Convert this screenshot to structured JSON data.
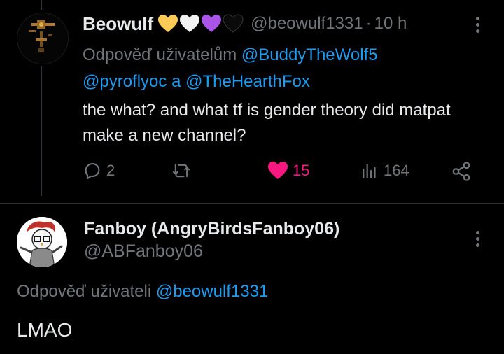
{
  "tweet1": {
    "display_name": "Beowulf",
    "badges": [
      "yellow-heart",
      "white-heart",
      "purple-heart",
      "black-heart"
    ],
    "handle": "@beowulf1331",
    "time": "10 h",
    "reply_prefix": "Odpověď uživatelům",
    "mention1": "@BuddyTheWolf5",
    "mention2": "@pyroflyoc",
    "joiner": "a",
    "mention3": "@TheHearthFox",
    "text": "the what? and what tf is gender theory did matpat make a new channel?",
    "replies": "2",
    "likes": "15",
    "views": "164"
  },
  "tweet2": {
    "display_name": "Fanboy (AngryBirdsFanboy06)",
    "handle": "@ABFanboy06",
    "reply_prefix": "Odpověď uživateli",
    "mention": "@beowulf1331",
    "text": "LMAO"
  },
  "colors": {
    "background": "#000000",
    "text": "#e7e9ea",
    "muted": "#71767b",
    "link": "#1d9bf0",
    "like": "#f91880"
  }
}
